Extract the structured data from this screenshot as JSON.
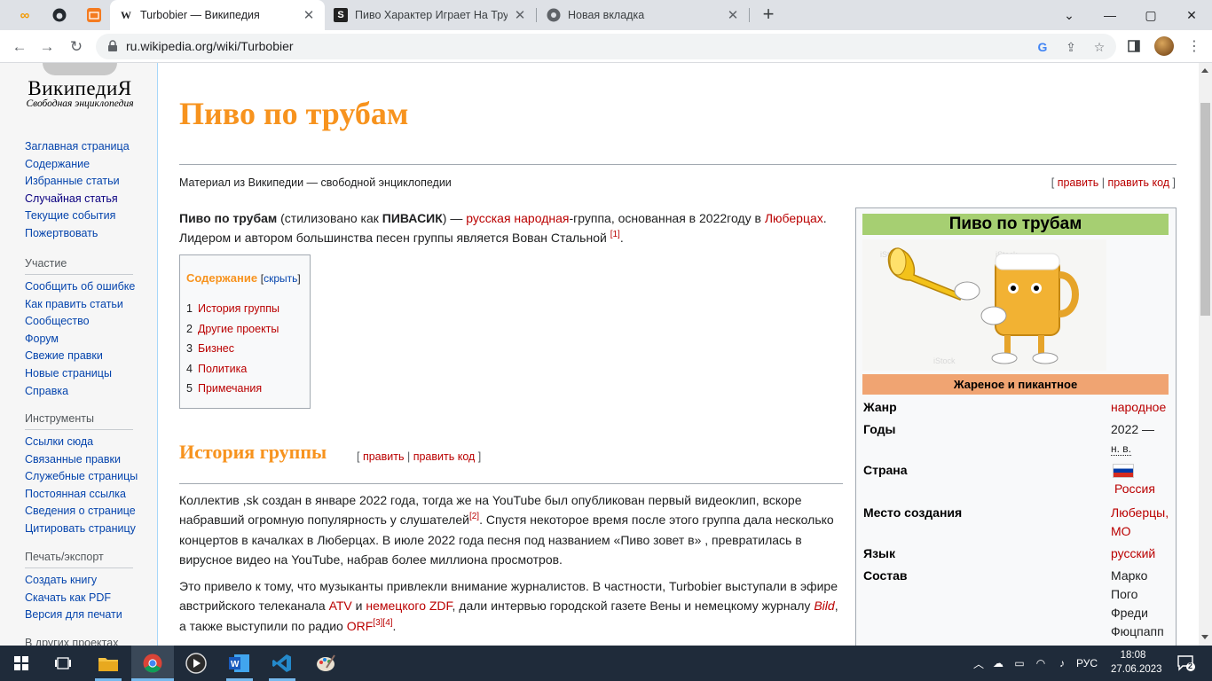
{
  "browser": {
    "tabs": [
      {
        "title": "Turbobier — Википедия",
        "favicon": "W",
        "active": true
      },
      {
        "title": "Пиво Характер Играет На Труб",
        "favicon": "S",
        "active": false
      },
      {
        "title": "Новая вкладка",
        "favicon": "chrome-icon",
        "active": false
      }
    ],
    "url": "ru.wikipedia.org/wiki/Turbobier",
    "new_tab_label": "+",
    "window_controls": {
      "minimize": "—",
      "maximize": "▢",
      "close": "✕"
    }
  },
  "wiki": {
    "logo_name": "ВикипедиЯ",
    "logo_tagline": "Свободная энциклопедия",
    "nav": [
      "Заглавная страница",
      "Содержание",
      "Избранные статьи",
      "Случайная статья",
      "Текущие события",
      "Пожертвовать"
    ],
    "participation_header": "Участие",
    "participation": [
      "Сообщить об ошибке",
      "Как править статьи",
      "Сообщество",
      "Форум",
      "Свежие правки",
      "Новые страницы",
      "Справка"
    ],
    "tools_header": "Инструменты",
    "tools": [
      "Ссылки сюда",
      "Связанные правки",
      "Служебные страницы",
      "Постоянная ссылка",
      "Сведения о странице",
      "Цитировать страницу"
    ],
    "print_header": "Печать/экспорт",
    "print": [
      "Создать книгу",
      "Скачать как PDF",
      "Версия для печати"
    ],
    "other_projects_header": "В других проектах"
  },
  "article": {
    "title": "Пиво по трубам",
    "tagline": "Материал из Википедии — свободной энциклопедии",
    "edit": "править",
    "edit_code": "править код",
    "lead": {
      "bold_name": "Пиво по трубам",
      "stylized_prefix": " (стилизовано как ",
      "stylized": "ПИВАСИК",
      "after_stylized": ") — ",
      "link_folk": "русская народная",
      "after_folk": "-группа, основанная в 2022году в ",
      "link_city": "Люберцах",
      "after_city": ". Лидером и автором большинства песен группы является Вован Стальной ",
      "ref1": "[1]",
      "end": "."
    },
    "toc": {
      "title": "Содержание",
      "hide": "скрыть",
      "items": [
        {
          "num": "1",
          "label": "История группы"
        },
        {
          "num": "2",
          "label": "Другие проекты"
        },
        {
          "num": "3",
          "label": "Бизнес"
        },
        {
          "num": "4",
          "label": "Политика"
        },
        {
          "num": "5",
          "label": "Примечания"
        }
      ]
    },
    "section1_title": "История группы",
    "p1": {
      "a": "Коллектив ,sk создан в январе 2022 года, тогда же на YouTube был опубликован первый видеоклип, вскоре набравший огромную популярность у слушателей",
      "ref": "[2]",
      "b": ". Спустя некоторое время после этого группа дала несколько концертов в качалках в Люберцах. В июле 2022 года песня под названием «Пиво зовет в» , превратилась в вирусное видео на YouTube, набрав более миллиона просмотров."
    },
    "p2": {
      "a": "Это привело к тому, что музыканты привлекли внимание журналистов. В частности, Turbobier выступали в эфире австрийского телеканала ",
      "link_atv": "ATV",
      "and": " и ",
      "link_zdf": "немецкого ZDF",
      "b": ", дали интервью городской газете Вены и немецкому журналу ",
      "bild": "Bild",
      "c": ", а также выступили по радио ",
      "link_orf": "ORF",
      "refs": "[3][4]",
      "end": "."
    }
  },
  "infobox": {
    "title": "Пиво по трубам",
    "image_alt": "beer-mug-trumpet-image",
    "watermark": "iStock",
    "caption": "Жареное и пикантное",
    "rows": {
      "genre_k": "Жанр",
      "genre_v": "народное",
      "years_k": "Годы",
      "years_v": "2022 —",
      "years_v2": "н. в.",
      "country_k": "Страна",
      "country_v": "Россия",
      "place_k": "Место создания",
      "place_v": "Люберцы, МО",
      "lang_k": "Язык",
      "lang_v": "русский",
      "members_k": "Состав",
      "members": [
        "Марко",
        "Пого",
        "Фреди",
        "Фюцпапп"
      ]
    }
  },
  "taskbar": {
    "lang": "РУС",
    "time": "18:08",
    "date": "27.06.2023",
    "notifications": "2"
  },
  "colors": {
    "title_orange": "#f7931e",
    "infobox_green": "#a6cf72",
    "caption_orange": "#f0a472",
    "link_blue": "#0645ad",
    "link_red": "#ba0000"
  }
}
